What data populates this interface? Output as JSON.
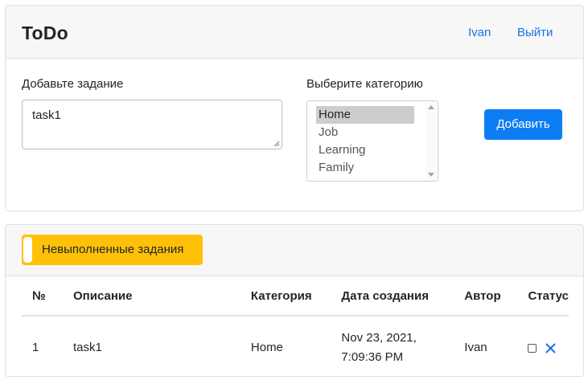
{
  "header": {
    "brand": "ToDo",
    "user": "Ivan",
    "logout": "Выйти"
  },
  "form": {
    "task_label": "Добавьте задание",
    "task_value": "task1",
    "category_label": "Выберите категорию",
    "categories": [
      "Home",
      "Job",
      "Learning",
      "Family"
    ],
    "selected_category": "Home",
    "add_button": "Добавить"
  },
  "filter": {
    "toggle_label": "Невыполненные задания"
  },
  "table": {
    "columns": [
      "№",
      "Описание",
      "Категория",
      "Дата создания",
      "Автор",
      "Статус"
    ],
    "rows": [
      {
        "num": "1",
        "description": "task1",
        "category": "Home",
        "date_line1": "Nov 23, 2021,",
        "date_line2": "7:09:36 PM",
        "author": "Ivan",
        "done": false
      }
    ]
  },
  "colors": {
    "primary": "#0d7df5",
    "warning": "#ffc107",
    "link": "#1a73e8",
    "delete_icon": "#1a73e8"
  },
  "icons": [
    "close-icon"
  ]
}
